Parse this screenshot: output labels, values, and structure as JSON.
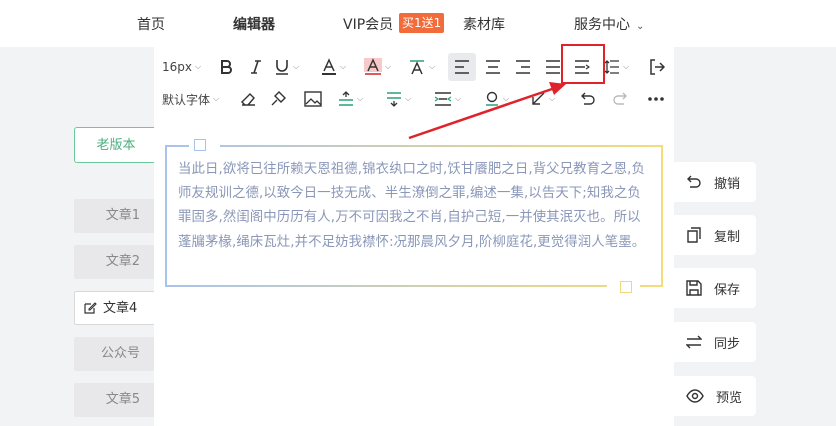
{
  "nav": {
    "items": [
      "首页",
      "编辑器",
      "VIP会员",
      "素材库",
      "服务中心"
    ],
    "vip_badge": "买1送1"
  },
  "sidebar": {
    "old_version": "老版本",
    "articles": [
      "文章1",
      "文章2",
      "文章4",
      "公众号",
      "文章5"
    ],
    "active_article": "文章4"
  },
  "toolbar": {
    "font_size": "16px",
    "font_family": "默认字体",
    "highlighted_button": "indent-icon"
  },
  "content": {
    "text": "当此日,欲将已往所赖天恩祖德,锦衣纨口之时,饫甘餍肥之日,背父兄教育之恩,负师友规训之德,以致今日一技无成、半生潦倒之罪,编述一集,以告天下;知我之负罪固多,然闺阁中历历有人,万不可因我之不肖,自护己短,一并使其泯灭也。所以蓬牖茅椽,绳床瓦灶,并不足妨我襟怀:况那晨风夕月,阶柳庭花,更觉得润人笔墨。"
  },
  "actions": [
    "撤销",
    "复制",
    "保存",
    "同步",
    "预览"
  ],
  "colors": {
    "accent_green": "#4cae80",
    "vip_badge": "#f26b3a",
    "annotation_red": "#e0222a",
    "content_text": "#8a97b8"
  }
}
